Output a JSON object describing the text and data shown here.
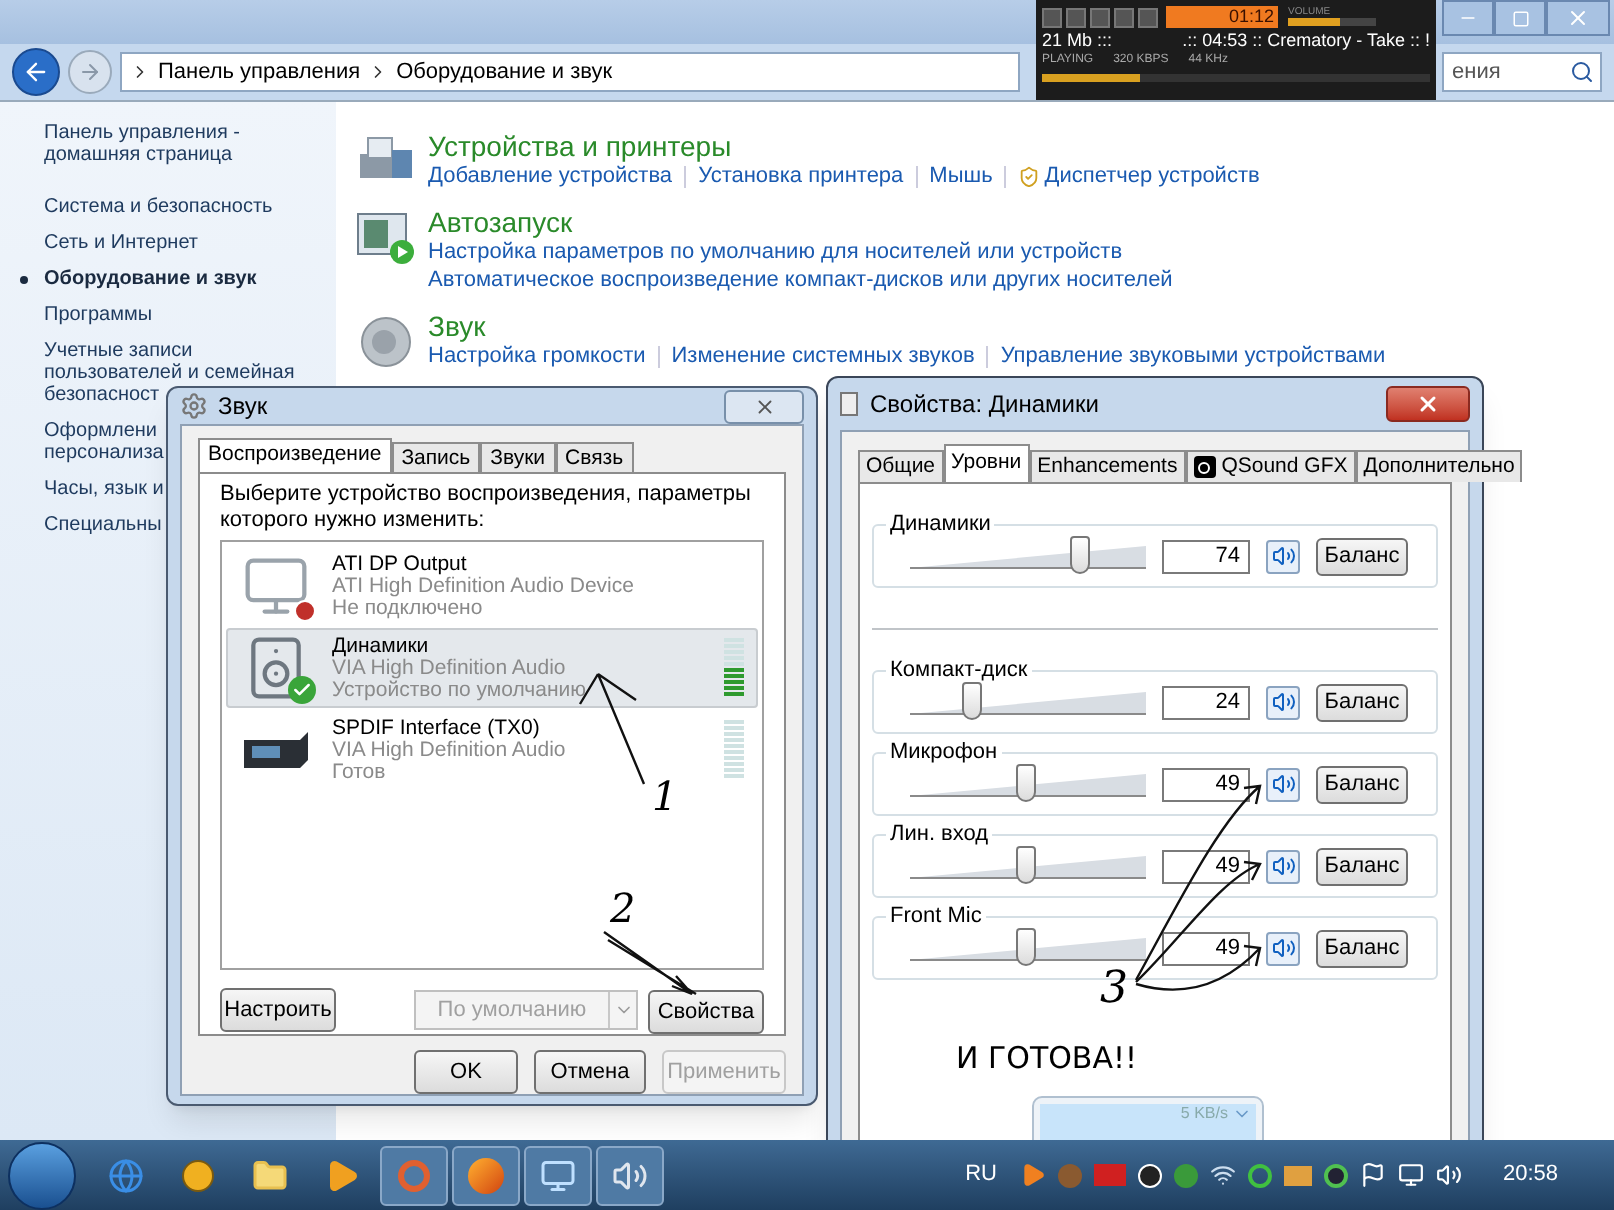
{
  "explorer": {
    "breadcrumb": [
      "Панель управления",
      "Оборудование и звук"
    ],
    "search": {
      "placeholder": "ения"
    }
  },
  "media_player": {
    "time": "01:12",
    "volume_label": "VOLUME",
    "volume": {
      "level": 0.6
    },
    "size": "21 Mb :::",
    "track": ".:: 04:53 :: Crematory - Take :: !",
    "status": "PLAYING",
    "bitrate": "320 KBPS",
    "frequency": "44 KHz",
    "seek": {
      "level": 0.25
    }
  },
  "sidebar": {
    "items": [
      {
        "lines": [
          "Панель управления -",
          "домашняя страница"
        ],
        "selected": false
      },
      {
        "lines": [
          "Система и безопасность"
        ],
        "selected": false
      },
      {
        "lines": [
          "Сеть и Интернет"
        ],
        "selected": false
      },
      {
        "lines": [
          "Оборудование и звук"
        ],
        "selected": true
      },
      {
        "lines": [
          "Программы"
        ],
        "selected": false
      },
      {
        "lines": [
          "Учетные записи",
          "пользователей и семейная",
          "безопасност"
        ],
        "selected": false
      },
      {
        "lines": [
          "Оформлени",
          "персонализа"
        ],
        "selected": false
      },
      {
        "lines": [
          "Часы, язык и"
        ],
        "selected": false
      },
      {
        "lines": [
          "Специальны"
        ],
        "selected": false
      }
    ]
  },
  "content": {
    "sections": [
      {
        "kind": "printer",
        "title": "Устройства и принтеры",
        "rows": [
          [
            {
              "label": "Добавление устройства",
              "kind": "plain"
            },
            {
              "label": "Установка принтера",
              "kind": "plain"
            },
            {
              "label": "Мышь",
              "kind": "plain"
            },
            {
              "label": "Диспетчер устройств",
              "kind": "shield"
            }
          ]
        ]
      },
      {
        "kind": "autoplay",
        "title": "Автозапуск",
        "rows": [
          [
            {
              "label": "Настройка параметров по умолчанию для носителей или устройств",
              "kind": "plain"
            }
          ],
          [
            {
              "label": "Автоматическое воспроизведение компакт-дисков или других носителей",
              "kind": "plain"
            }
          ]
        ]
      },
      {
        "kind": "sound",
        "title": "Звук",
        "rows": [
          [
            {
              "label": "Настройка громкости",
              "kind": "plain"
            },
            {
              "label": "Изменение системных звуков",
              "kind": "plain"
            },
            {
              "label": "Управление звуковыми устройствами",
              "kind": "plain"
            }
          ]
        ]
      }
    ]
  },
  "sound_dialog": {
    "title": "Звук",
    "tabs": [
      {
        "label": "Воспроизведение",
        "selected": true
      },
      {
        "label": "Запись",
        "selected": false
      },
      {
        "label": "Звуки",
        "selected": false
      },
      {
        "label": "Связь",
        "selected": false
      }
    ],
    "instruction": "Выберите устройство воспроизведения, параметры которого нужно изменить:",
    "devices": [
      {
        "kind": "monitor",
        "name": "ATI DP Output",
        "driver": "ATI High Definition Audio Device",
        "status": "Не подключено",
        "selected": false,
        "disconnected": true,
        "default": false
      },
      {
        "kind": "speaker",
        "name": "Динамики",
        "driver": "VIA High Definition Audio",
        "status": "Устройство по умолчанию",
        "selected": true,
        "disconnected": false,
        "default": true,
        "level": 0.5
      },
      {
        "kind": "receiver",
        "name": "SPDIF Interface (TX0)",
        "driver": "VIA High Definition Audio",
        "status": "Готов",
        "selected": false,
        "disconnected": false,
        "default": false,
        "level": 0
      }
    ],
    "configure": {
      "label": "Настроить",
      "disabled": false
    },
    "set_default": {
      "label": "По умолчанию",
      "disabled": true
    },
    "properties": {
      "label": "Свойства",
      "disabled": false
    },
    "ok": {
      "label": "OK",
      "disabled": false
    },
    "cancel": {
      "label": "Отмена",
      "disabled": false
    },
    "apply": {
      "label": "Применить",
      "disabled": true
    }
  },
  "properties_dialog": {
    "title": "Свойства: Динамики",
    "tabs": [
      {
        "label": "Общие",
        "selected": false,
        "kind": "text"
      },
      {
        "label": "Уровни",
        "selected": true,
        "kind": "text"
      },
      {
        "label": "Enhancements",
        "selected": false,
        "kind": "text"
      },
      {
        "label": "QSound GFX",
        "selected": false,
        "kind": "icon"
      },
      {
        "label": "Дополнительно",
        "selected": false,
        "kind": "text"
      }
    ],
    "master": {
      "name": "Динамики",
      "value": "74",
      "level": 0.74,
      "muted": false,
      "balance": "Баланс"
    },
    "channels": [
      {
        "name": "Компакт-диск",
        "value": "24",
        "level": 0.24,
        "muted": false,
        "balance": "Баланс"
      },
      {
        "name": "Микрофон",
        "value": "49",
        "level": 0.49,
        "muted": false,
        "balance": "Баланс"
      },
      {
        "name": "Лин. вход",
        "value": "49",
        "level": 0.49,
        "muted": false,
        "balance": "Баланс"
      },
      {
        "name": "Front Mic",
        "value": "49",
        "level": 0.49,
        "muted": false,
        "balance": "Баланс"
      }
    ]
  },
  "network_gadget": {
    "speed": "5 KB/s"
  },
  "annotations": {
    "step_1": "1",
    "step_2": "2",
    "step_3": "3",
    "note": "И ГОТОВА!!"
  },
  "taskbar": {
    "buttons": [
      {
        "kind": "ie",
        "open": false
      },
      {
        "kind": "player",
        "open": false
      },
      {
        "kind": "folder",
        "open": false
      },
      {
        "kind": "media",
        "open": false
      },
      {
        "kind": "ring",
        "open": true
      },
      {
        "kind": "firefox",
        "open": true
      },
      {
        "kind": "panel",
        "open": true
      },
      {
        "kind": "sound",
        "open": true
      }
    ],
    "language": "RU",
    "clock": "20:58"
  }
}
